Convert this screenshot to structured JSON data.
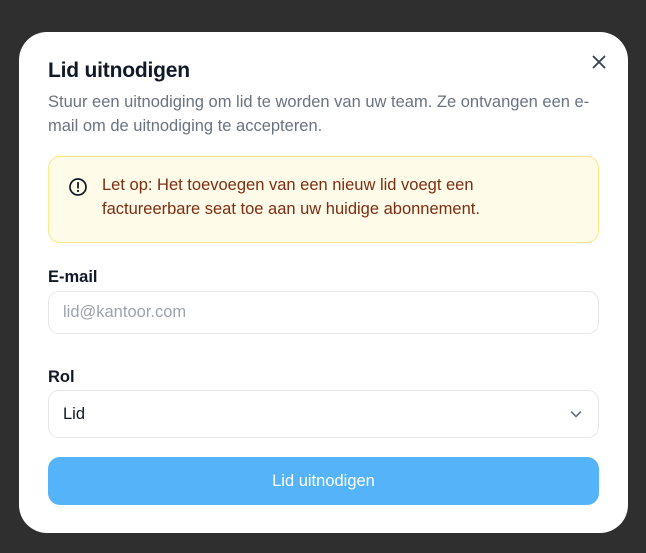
{
  "dialog": {
    "title": "Lid uitnodigen",
    "description": "Stuur een uitnodiging om lid te worden van uw team. Ze ontvangen een e-mail om de uitnodiging te accepteren.",
    "close_icon": "close-icon"
  },
  "alert": {
    "icon": "alert-circle-icon",
    "text": "Let op: Het toevoegen van een nieuw lid voegt een factureerbare seat toe aan uw huidige abonnement."
  },
  "form": {
    "email": {
      "label": "E-mail",
      "placeholder": "lid@kantoor.com",
      "value": ""
    },
    "role": {
      "label": "Rol",
      "value": "Lid",
      "icon": "chevron-down-icon"
    },
    "submit_label": "Lid uitnodigen"
  },
  "colors": {
    "backdrop": "#2f2f2f",
    "accent": "#54b3f9",
    "alert_bg": "#fefbe8",
    "alert_border": "#fde68a",
    "alert_text": "#7c2d12"
  }
}
